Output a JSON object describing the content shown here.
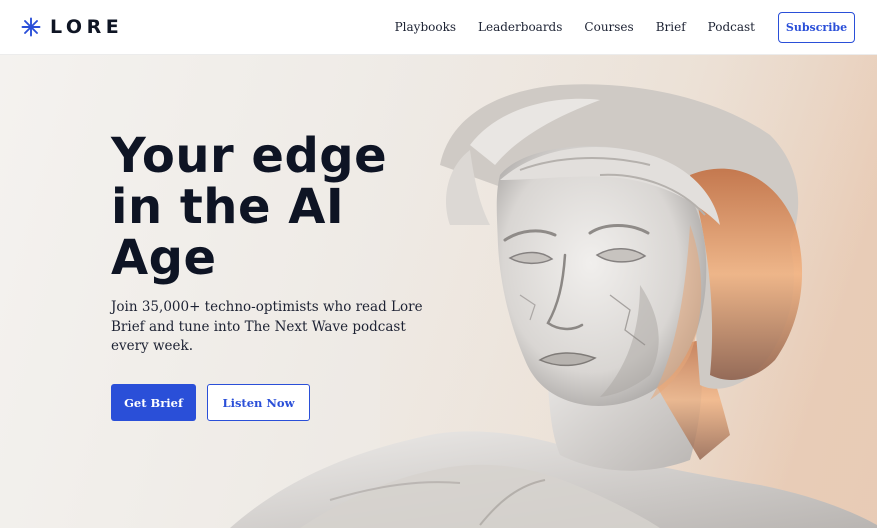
{
  "header": {
    "logo_text": "LORE",
    "logo_icon": "asterisk-snowflake-icon",
    "nav": [
      "Playbooks",
      "Leaderboards",
      "Courses",
      "Brief",
      "Podcast"
    ],
    "subscribe_label": "Subscribe"
  },
  "hero": {
    "title_lines": [
      "Your edge",
      "in the AI",
      "Age"
    ],
    "subtitle": "Join 35,000+ techno-optimists who read Lore Brief and tune into The Next Wave podcast every week.",
    "primary_button": "Get Brief",
    "secondary_button": "Listen Now",
    "image_subject": "marble-statue-bust"
  },
  "colors": {
    "accent": "#2a4fd8",
    "heading": "#0e1424",
    "hero_background": "#eeeae5"
  }
}
